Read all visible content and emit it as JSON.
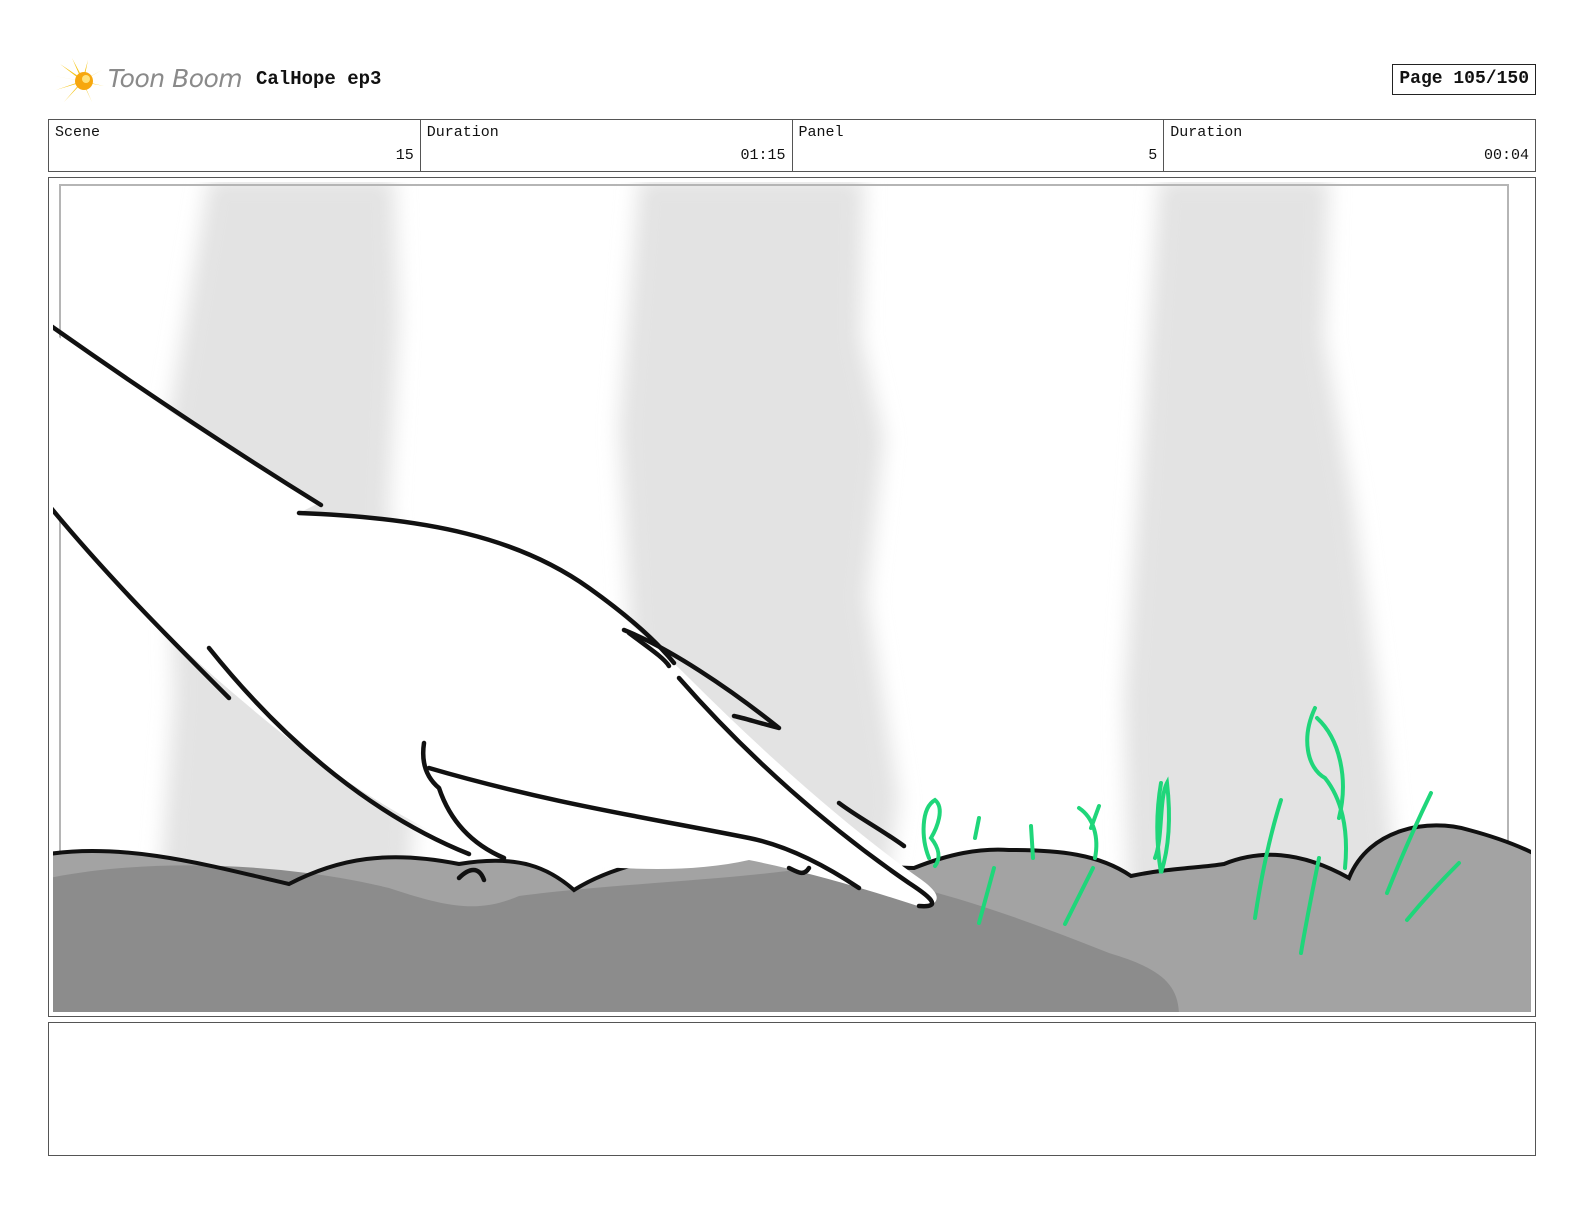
{
  "header": {
    "logo_text": "Toon Boom",
    "project_title": "CalHope ep3",
    "page_label": "Page 105/150"
  },
  "info": {
    "scene_label": "Scene",
    "scene_value": "15",
    "scene_duration_label": "Duration",
    "scene_duration_value": "01:15",
    "panel_label": "Panel",
    "panel_value": "5",
    "panel_duration_label": "Duration",
    "panel_duration_value": "00:04"
  },
  "colors": {
    "logo_star": "#f5c518",
    "ground_light": "#a3a3a3",
    "ground_dark": "#8c8c8c",
    "tree_trunk": "#e6e6e6",
    "sprout_green": "#1fd67a"
  },
  "notes": {
    "text": ""
  }
}
